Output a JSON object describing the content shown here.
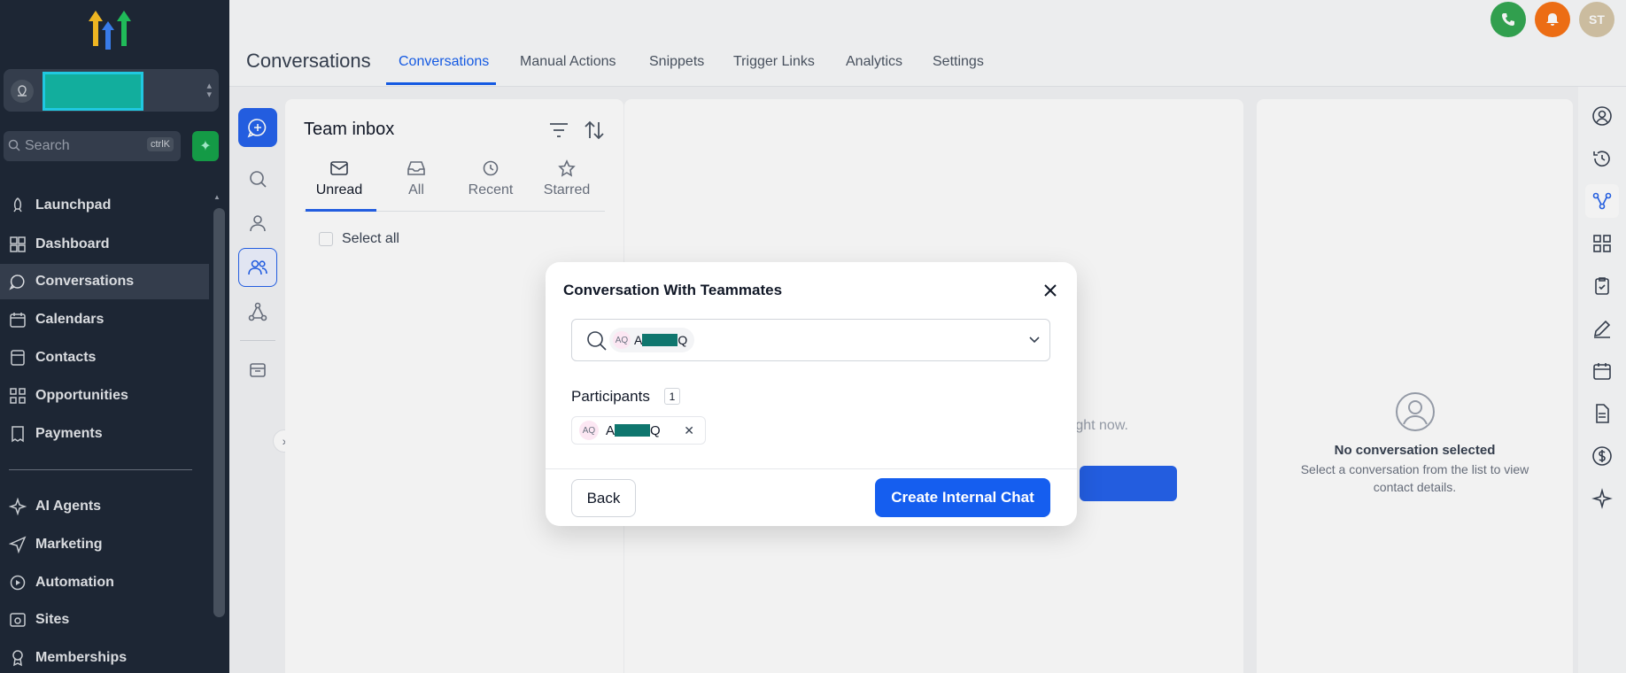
{
  "colors": {
    "sidebar_bg": "#1f2937",
    "accent": "#155eef",
    "phone_green": "#34a853",
    "bell_orange": "#f97316",
    "avatar_tan": "#d6c7a8",
    "redaction": "#14b8a6"
  },
  "sidebar": {
    "search_placeholder": "Search",
    "search_shortcut": "ctrlK",
    "items": [
      {
        "label": "Launchpad",
        "icon": "rocket-icon"
      },
      {
        "label": "Dashboard",
        "icon": "grid-icon"
      },
      {
        "label": "Conversations",
        "icon": "chat-icon",
        "active": true
      },
      {
        "label": "Calendars",
        "icon": "calendar-icon"
      },
      {
        "label": "Contacts",
        "icon": "contacts-icon"
      },
      {
        "label": "Opportunities",
        "icon": "opportunities-icon"
      },
      {
        "label": "Payments",
        "icon": "receipt-icon"
      },
      {
        "label": "AI Agents",
        "icon": "sparkle-icon"
      },
      {
        "label": "Marketing",
        "icon": "send-icon"
      },
      {
        "label": "Automation",
        "icon": "automation-icon"
      },
      {
        "label": "Sites",
        "icon": "sites-icon"
      },
      {
        "label": "Memberships",
        "icon": "membership-icon"
      }
    ]
  },
  "header": {
    "title": "Conversations",
    "tabs": [
      {
        "label": "Conversations",
        "active": true
      },
      {
        "label": "Manual Actions"
      },
      {
        "label": "Snippets"
      },
      {
        "label": "Trigger Links"
      },
      {
        "label": "Analytics"
      },
      {
        "label": "Settings"
      }
    ],
    "user_initials": "ST"
  },
  "inbox": {
    "title": "Team inbox",
    "filters": [
      {
        "label": "Unread",
        "icon": "mail-icon",
        "active": true
      },
      {
        "label": "All",
        "icon": "inbox-icon"
      },
      {
        "label": "Recent",
        "icon": "history-icon"
      },
      {
        "label": "Starred",
        "icon": "star-icon"
      }
    ],
    "select_all": "Select all"
  },
  "center": {
    "hint": "s right now."
  },
  "contact": {
    "title": "No conversation selected",
    "subtitle": "Select a conversation from the list to view contact details."
  },
  "modal": {
    "title": "Conversation With Teammates",
    "search_chip": {
      "initials": "AQ",
      "first": "A",
      "last": "Q"
    },
    "participants_label": "Participants",
    "participants_count": "1",
    "participant": {
      "initials": "AQ",
      "first": "A",
      "last": "Q"
    },
    "back_label": "Back",
    "create_label": "Create Internal Chat"
  }
}
